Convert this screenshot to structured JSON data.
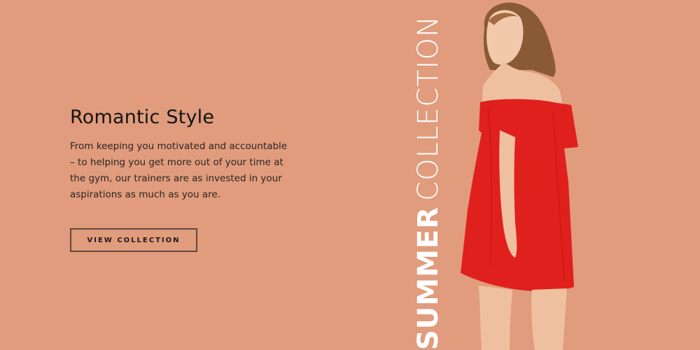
{
  "hero": {
    "title": "Romantic Style",
    "description": "From keeping you motivated and accountable – to helping you get more out of your time at the gym, our trainers are as invested in your aspirations as much as you are.",
    "button_label": "VIEW COLLECTION"
  },
  "vertical_title": {
    "strong": "SUMMER",
    "light": "COLLECTION"
  },
  "colors": {
    "background": "#e09c7d",
    "dress": "#e0201c",
    "title_text": "#ffffff",
    "body_text": "#2a2522"
  }
}
